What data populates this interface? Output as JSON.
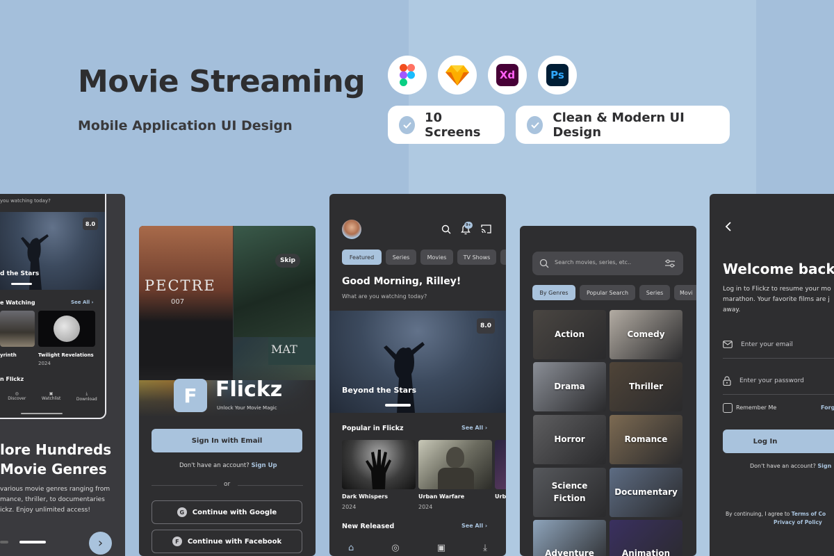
{
  "hero": {
    "title": "Movie Streaming",
    "subtitle": "Mobile Application UI Design",
    "tools": [
      "figma-icon",
      "sketch-icon",
      "xd-icon",
      "photoshop-icon"
    ],
    "xd_label": "Xd",
    "ps_label": "Ps",
    "features": [
      "10 Screens",
      "Clean & Modern UI Design"
    ]
  },
  "colors": {
    "accent": "#a9c3dd",
    "phone": "#2e2e30",
    "background": "#a4bfdb"
  },
  "screen1": {
    "prompt": "you watching today?",
    "rating": "8.0",
    "hero_title": "d the Stars",
    "section": "e Watching",
    "see_all": "See All",
    "items": [
      {
        "title": "yrinth",
        "year": ""
      },
      {
        "title": "Twilight Revelations",
        "year": "2024"
      }
    ],
    "section2": "n Flickz",
    "nav": [
      "Discover",
      "Watchlist",
      "Download"
    ],
    "explore_title_1": "lore Hundreds",
    "explore_title_2": "Movie Genres",
    "explore_body": [
      "various movie genres ranging from",
      "mance, thriller, to documentaries",
      "ickz. Enjoy unlimited access!"
    ]
  },
  "screen2": {
    "skip": "Skip",
    "poster_text_1": "PECTRE",
    "poster_text_2": "007",
    "poster_text_3": "MAT",
    "logo_letter": "F",
    "app_name": "Flickz",
    "tagline": "Unlock Your Movie Magic",
    "signin": "Sign In with Email",
    "no_account": "Don't have an account?",
    "signup": "Sign Up",
    "or": "or",
    "google": "Continue with Google",
    "google_icon": "G",
    "facebook": "Continue with Facebook",
    "facebook_icon": "F"
  },
  "screen3": {
    "notif_count": "9+",
    "tabs": [
      "Featured",
      "Series",
      "Movies",
      "TV Shows"
    ],
    "greeting": "Good Morning, Rilley!",
    "prompt": "What are you watching today?",
    "rating": "8.0",
    "hero_title": "Beyond the Stars",
    "popular": "Popular in Flickz",
    "see_all": "See All",
    "movies": [
      {
        "title": "Dark Whispers",
        "year": "2024"
      },
      {
        "title": "Urban Warfare",
        "year": "2024"
      },
      {
        "title": "Urb",
        "year": ""
      }
    ],
    "new_released": "New Released",
    "see_all_2": "See All"
  },
  "screen4": {
    "search_placeholder": "Search movies, series, etc..",
    "tabs": [
      "By Genres",
      "Popular Search",
      "Series",
      "Movi"
    ],
    "genres": [
      {
        "label": "Action",
        "color": "#4a4642"
      },
      {
        "label": "Comedy",
        "color": "#b3aca3"
      },
      {
        "label": "Drama",
        "color": "#8a8e96"
      },
      {
        "label": "Thriller",
        "color": "#4f4438"
      },
      {
        "label": "Horror",
        "color": "#5e5e60"
      },
      {
        "label": "Romance",
        "color": "#7c6a52"
      },
      {
        "label": "Science\nFiction",
        "color": "#56585c"
      },
      {
        "label": "Documentary",
        "color": "#5d6c83"
      },
      {
        "label": "Adventure",
        "color": "#8ea4bb"
      },
      {
        "label": "Animation",
        "color": "#3a3060"
      }
    ]
  },
  "screen5": {
    "title": "Welcome back",
    "body_1": "Log in to Flickz to resume your mo",
    "body_2": "marathon. Your favorite films are j",
    "body_3": "away.",
    "email_placeholder": "Enter your email",
    "password_placeholder": "Enter your password",
    "remember": "Remember Me",
    "forgot": "Forg",
    "login": "Log In",
    "no_account": "Don't have an account?",
    "signup": "Sign",
    "terms_prefix": "By continuing, I agree to",
    "terms_link": "Terms of Co",
    "privacy_link": "Privacy of Policy"
  }
}
